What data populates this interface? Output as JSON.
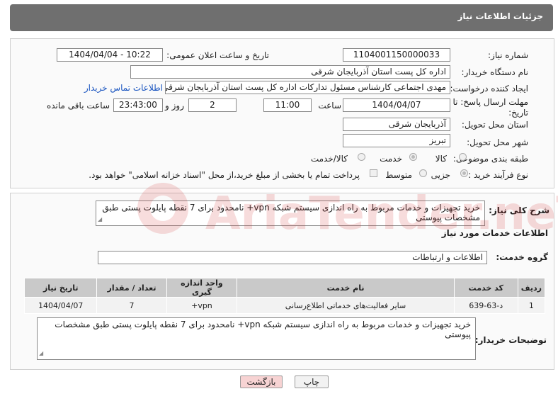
{
  "header": {
    "title": "جزئیات اطلاعات نیاز"
  },
  "form": {
    "need_number_label": "شماره نیاز:",
    "need_number": "1104001150000033",
    "announce_label": "تاریخ و ساعت اعلان عمومی:",
    "announce_value": "1404/04/04 - 10:22",
    "buyer_org_label": "نام دستگاه خریدار:",
    "buyer_org": "اداره کل پست استان آذربایجان شرقی",
    "creator_label": "ایجاد کننده درخواست:",
    "creator": "مهدی اجتماعی کارشناس مسئول تدارکات اداره کل پست استان آذربایجان شرقی",
    "contact_link": "اطلاعات تماس خریدار",
    "deadline_label_1": "مهلت ارسال پاسخ: تا",
    "deadline_label_2": "تاریخ:",
    "deadline_date": "1404/04/07",
    "time_label": "ساعت",
    "deadline_time": "11:00",
    "days_value": "2",
    "days_label": "روز و",
    "remaining_time": "23:43:00",
    "remaining_label": "ساعت باقی مانده",
    "province_label": "استان محل تحویل:",
    "province": "آذربایجان شرقی",
    "city_label": "شهر محل تحویل:",
    "city": "تبریز",
    "category_label": "طبقه بندی موضوعی:",
    "category_options": [
      "کالا",
      "خدمت",
      "کالا/خدمت"
    ],
    "category_selected": "خدمت",
    "process_label": "نوع فرآیند خرید :",
    "process_options": [
      "جزیی",
      "متوسط"
    ],
    "process_selected": "جزیی",
    "payment_note": "پرداخت تمام یا بخشی از مبلغ خرید،از محل \"اسناد خزانه اسلامی\" خواهد بود."
  },
  "summary": {
    "label": "شرح کلی نیاز:",
    "text": "خرید تجهیزات  و خدمات مربوط به راه اندازی سیستم شبکه vpn+ نامحدود برای 7 نقطه پایلوت پستی طبق مشخصات پیوستی"
  },
  "services": {
    "section_title": "اطلاعات خدمات مورد نیاز",
    "group_label": "گروه خدمت:",
    "group_value": "اطلاعات و ارتباطات",
    "columns": [
      "ردیف",
      "کد خدمت",
      "نام خدمت",
      "واحد اندازه گیری",
      "تعداد / مقدار",
      "تاریخ نیاز"
    ],
    "rows": [
      [
        "1",
        "د-63-639",
        "سایر فعالیت‌های خدماتی اطلاع‌رسانی",
        "vpn+",
        "7",
        "1404/04/07"
      ]
    ]
  },
  "buyer_notes": {
    "label": "توضیحات خریدار:",
    "text": "خرید تجهیزات  و خدمات مربوط به راه اندازی سیستم شبکه vpn+ نامحدود برای 7 نقطه پایلوت پستی طبق مشخصات پیوستی"
  },
  "buttons": {
    "print": "چاپ",
    "back": "بازگشت"
  },
  "watermark": {
    "text": "AriaTender.neT"
  },
  "colors": {
    "header_bg": "#6f6f6f",
    "back_button_bg": "#f7d3d3",
    "link": "#1a55c0",
    "table_header": "#c9c9c9"
  }
}
